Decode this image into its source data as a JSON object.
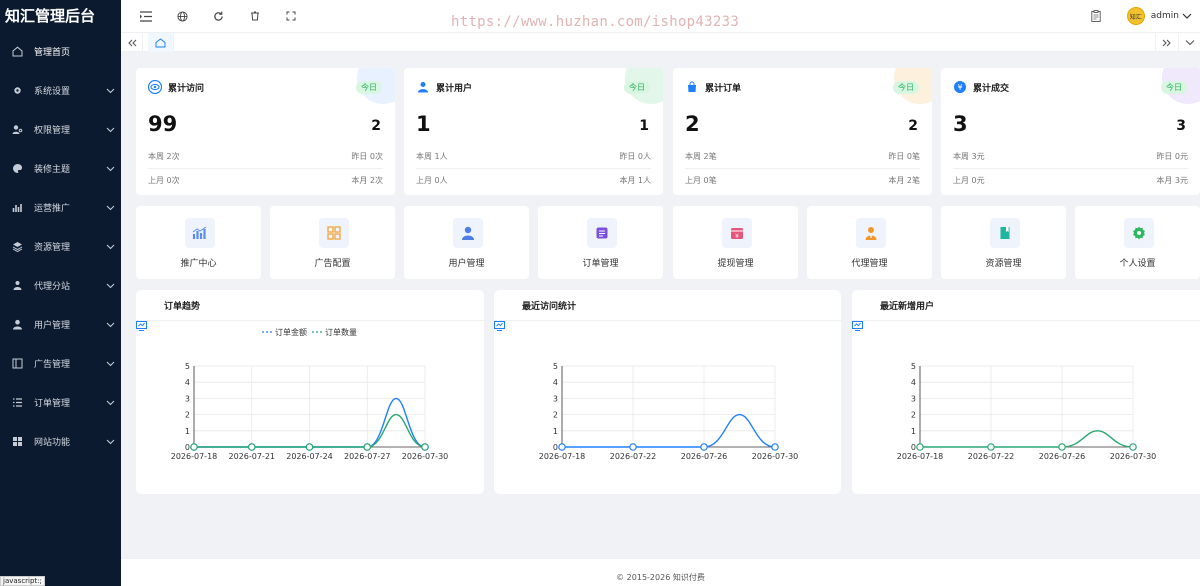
{
  "app": {
    "title": "知汇管理后台"
  },
  "sidebar": {
    "items": [
      {
        "label": "管理首页",
        "icon": "home-icon",
        "has_arrow": false
      },
      {
        "label": "系统设置",
        "icon": "gear-icon",
        "has_arrow": true
      },
      {
        "label": "权限管理",
        "icon": "user-key-icon",
        "has_arrow": true
      },
      {
        "label": "装修主题",
        "icon": "palette-icon",
        "has_arrow": true
      },
      {
        "label": "运营推广",
        "icon": "chart-bar-icon",
        "has_arrow": true
      },
      {
        "label": "资源管理",
        "icon": "layers-icon",
        "has_arrow": true
      },
      {
        "label": "代理分站",
        "icon": "agent-icon",
        "has_arrow": true
      },
      {
        "label": "用户管理",
        "icon": "user-icon",
        "has_arrow": true
      },
      {
        "label": "广告管理",
        "icon": "ad-icon",
        "has_arrow": true
      },
      {
        "label": "订单管理",
        "icon": "list-icon",
        "has_arrow": true
      },
      {
        "label": "网站功能",
        "icon": "grid-icon",
        "has_arrow": true
      }
    ]
  },
  "header": {
    "watermark": "https://www.huzhan.com/ishop43233",
    "admin_name": "admin",
    "avatar_text": "知汇"
  },
  "stats": [
    {
      "title": "累计访问",
      "badge": "今日",
      "total": "99",
      "today": "2",
      "week_label": "本周 2次",
      "yesterday_label": "昨日 0次",
      "lastmonth_label": "上月 0次",
      "month_label": "本月 2次",
      "color": "#1e80ff",
      "deco": "#e8f1ff",
      "icon": "eye-icon"
    },
    {
      "title": "累计用户",
      "badge": "今日",
      "total": "1",
      "today": "1",
      "week_label": "本周 1人",
      "yesterday_label": "昨日 0人",
      "lastmonth_label": "上月 0人",
      "month_label": "本月 1人",
      "color": "#1e80ff",
      "deco": "#e3f6ea",
      "icon": "user-icon"
    },
    {
      "title": "累计订单",
      "badge": "今日",
      "total": "2",
      "today": "2",
      "week_label": "本周 2笔",
      "yesterday_label": "昨日 0笔",
      "lastmonth_label": "上月 0笔",
      "month_label": "本月 2笔",
      "color": "#1e80ff",
      "deco": "#fdf0dd",
      "icon": "bag-icon"
    },
    {
      "title": "累计成交",
      "badge": "今日",
      "total": "3",
      "today": "3",
      "week_label": "本周 3元",
      "yesterday_label": "昨日 0元",
      "lastmonth_label": "上月 0元",
      "month_label": "本月 3元",
      "color": "#1e80ff",
      "deco": "#efe9fb",
      "icon": "money-icon"
    }
  ],
  "quick_links": [
    {
      "label": "推广中心",
      "icon": "promotion-chart-icon",
      "color": "#5b8def"
    },
    {
      "label": "广告配置",
      "icon": "ad-grid-icon",
      "color": "#f0a63a"
    },
    {
      "label": "用户管理",
      "icon": "user-icon",
      "color": "#4c7ee6"
    },
    {
      "label": "订单管理",
      "icon": "order-icon",
      "color": "#7b4fe0"
    },
    {
      "label": "提现管理",
      "icon": "withdraw-icon",
      "color": "#e6557a"
    },
    {
      "label": "代理管理",
      "icon": "agent-icon",
      "color": "#f0962a"
    },
    {
      "label": "资源管理",
      "icon": "book-icon",
      "color": "#1fb5a0"
    },
    {
      "label": "个人设置",
      "icon": "gear-icon",
      "color": "#2cb85c"
    }
  ],
  "panels": [
    {
      "title": "订单趋势",
      "icon": "monitor-icon"
    },
    {
      "title": "最近访问统计",
      "icon": "monitor-icon"
    },
    {
      "title": "最近新增用户",
      "icon": "monitor-icon"
    }
  ],
  "chart_data": [
    {
      "type": "line",
      "title": "订单趋势",
      "x": [
        "2026-07-18",
        "2026-07-21",
        "2026-07-24",
        "2026-07-27",
        "2026-07-30"
      ],
      "series": [
        {
          "name": "订单金额",
          "values": [
            0,
            0,
            0,
            0,
            0
          ],
          "peak": {
            "value": 3,
            "color": "#1e80ff"
          }
        },
        {
          "name": "订单数量",
          "values": [
            0,
            0,
            0,
            0,
            0
          ],
          "peak": {
            "value": 2,
            "color": "#2aa872"
          }
        }
      ],
      "ylim": [
        0,
        5
      ],
      "yticks": [
        0,
        1,
        2,
        3,
        4,
        5
      ],
      "grid": true,
      "legend": "top-center"
    },
    {
      "type": "line",
      "title": "最近访问统计",
      "x": [
        "2026-07-18",
        "2026-07-22",
        "2026-07-26",
        "2026-07-30"
      ],
      "series": [
        {
          "values": [
            0,
            0,
            0,
            0
          ],
          "peak": {
            "value": 2,
            "color": "#1e80ff"
          }
        }
      ],
      "ylim": [
        0,
        5
      ],
      "yticks": [
        0,
        1,
        2,
        3,
        4,
        5
      ],
      "grid": true
    },
    {
      "type": "line",
      "title": "最近新增用户",
      "x": [
        "2026-07-18",
        "2026-07-22",
        "2026-07-26",
        "2026-07-30"
      ],
      "series": [
        {
          "values": [
            0,
            0,
            0,
            0
          ],
          "peak": {
            "value": 1,
            "color": "#2aa872"
          }
        }
      ],
      "ylim": [
        0,
        5
      ],
      "yticks": [
        0,
        1,
        2,
        3,
        4,
        5
      ],
      "grid": true
    }
  ],
  "footer": {
    "copyright": "© 2015-2026 知识付费"
  },
  "status_bar": {
    "text": "javascript:;"
  }
}
